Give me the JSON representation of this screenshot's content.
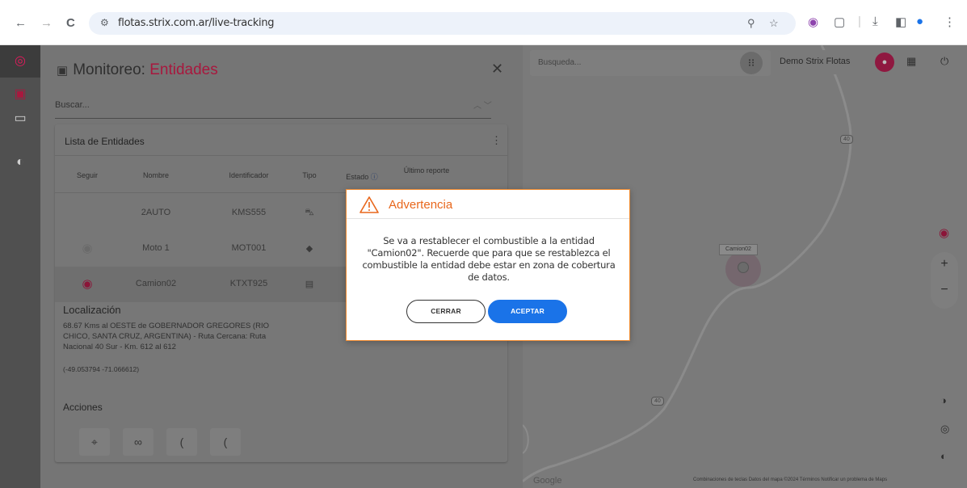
{
  "browser": {
    "url": "flotas.strix.com.ar/live-tracking",
    "nav_back": "←",
    "nav_forward": "→",
    "nav_reload": "C",
    "site_info": "⚙"
  },
  "panel": {
    "title_prefix": "Monitoreo: ",
    "title_accent": "Entidades",
    "search_placeholder": "Buscar...",
    "list_title": "Lista de Entidades",
    "columns": [
      "Seguir",
      "Nombre",
      "Identificador",
      "Tipo",
      "Estado",
      "Último reporte"
    ],
    "rows": [
      {
        "name": "2AUTO",
        "id": "KMS555",
        "type_icon": "car-icon",
        "follow": ""
      },
      {
        "name": "Moto 1",
        "id": "MOT001",
        "type_icon": "motorcycle-icon",
        "follow": "eye-off"
      },
      {
        "name": "Camion02",
        "id": "KTXT925",
        "type_icon": "truck-icon",
        "follow": "eye-on"
      }
    ],
    "location_heading": "Localización",
    "location_text": "68.67 Kms al OESTE de GOBERNADOR GREGORES (RIO CHICO, SANTA CRUZ, ARGENTINA) - Ruta Cercana: Ruta Nacional 40 Sur - Km. 612 al 612",
    "location_coords": "(-49.053794 -71.066612)",
    "actions_heading": "Acciones"
  },
  "map": {
    "search_placeholder": "Busqueda...",
    "user_name": "Demo Strix Flotas",
    "vehicle_label": "Camion02",
    "route_labels": [
      "40",
      "40"
    ],
    "google": "Google",
    "footer": "Combinaciones de teclas   Datos del mapa ©2024   Términos   Notificar un problema de Maps"
  },
  "dialog": {
    "title": "Advertencia",
    "message": "Se va a restablecer el combustible a la entidad \"Camion02\". Recuerde que para que se restablezca el combustible la entidad debe estar en zona de cobertura de datos.",
    "cancel_label": "CERRAR",
    "accept_label": "ACEPTAR"
  },
  "colors": {
    "accent": "#e11b5c",
    "warning": "#e8671c",
    "primary_button": "#1a73e8"
  }
}
